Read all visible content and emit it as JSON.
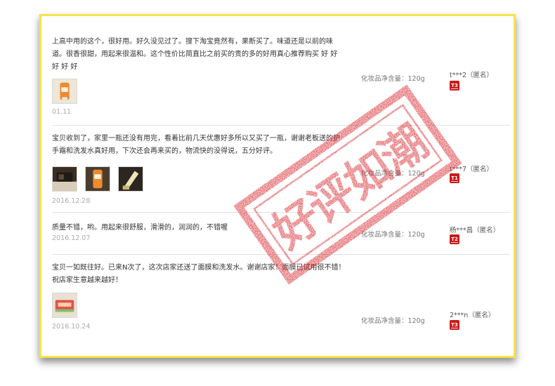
{
  "reviews": [
    {
      "text": "上高中用的这个，很好用。好久没见过了。搜下淘宝竟然有，果断买了。味道还是以前的味道。很香很甜，用起来很温和。这个性价比简直比之前买的贵的多的好用真心推荐购买 好 好 好 好 好",
      "date": "01.11",
      "spec": "化妆品净含量：120g",
      "user": "t***2（匿名）",
      "level": "T3",
      "images": [
        "orange-tube-photo"
      ]
    },
    {
      "text": "宝贝收到了，家里一瓶还没有用完，看着比前几天优惠好多所以又买了一瓶，谢谢老板送的护手霜和洗发水真好用，下次还会再来买的，物流快的没得说，五分好评。",
      "date": "2016.12.28",
      "spec": "化妆品净含量：120g",
      "user": "t***7（匿名）",
      "level": "T1",
      "images": [
        "product-photo-dark",
        "orange-tube-photo",
        "cream-tube-photo"
      ]
    },
    {
      "text": "质量不错，哟。用起来很舒服，滑滑的，润润的，不错喔",
      "date": "2016.12.07",
      "spec": "化妆品净含量：120g",
      "user": "杨***昌（匿名）",
      "level": "T2",
      "images": []
    },
    {
      "text": "宝贝一如既往好。已来N次了，这次店家还送了面膜和洗发水。谢谢店家！面膜已试用很不错！祝店家生意越来越好！",
      "date": "2016.10.24",
      "spec": "化妆品净含量：120g",
      "user": "2***n（匿名）",
      "level": "T3",
      "images": [
        "mask-pack-photo"
      ]
    }
  ],
  "stamp": {
    "text": "好评如潮",
    "color": "#d8242b"
  },
  "colors": {
    "frame_border": "#f7e348",
    "level_badge": "#c91a1a"
  }
}
